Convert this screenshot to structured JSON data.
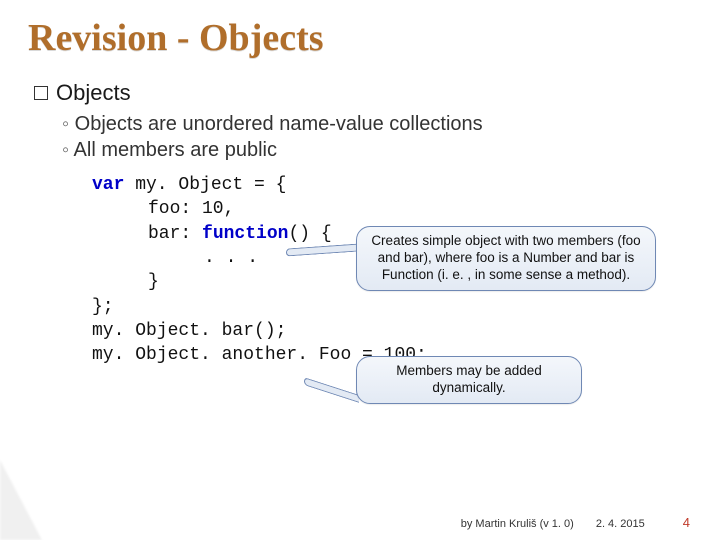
{
  "title": "Revision - Objects",
  "section": "Objects",
  "bullets": [
    "Objects are unordered name-value collections",
    "All members are public"
  ],
  "code": {
    "l1a": "var",
    "l1b": " my. Object = {",
    "l2": "foo: 10,",
    "l3a": "bar: ",
    "l3b": "function",
    "l3c": "() {",
    "l4": ". . .",
    "l5": "}",
    "l6": "};",
    "l7": "my. Object. bar();",
    "l8": "my. Object. another. Foo = 100;"
  },
  "callout1": "Creates simple object with two members (foo and bar), where foo is a Number and bar is Function (i. e. , in some sense a method).",
  "callout2": "Members may be added dynamically.",
  "footer": {
    "author": "by Martin Kruliš (v 1. 0)",
    "date": "2. 4. 2015",
    "page": "4"
  }
}
